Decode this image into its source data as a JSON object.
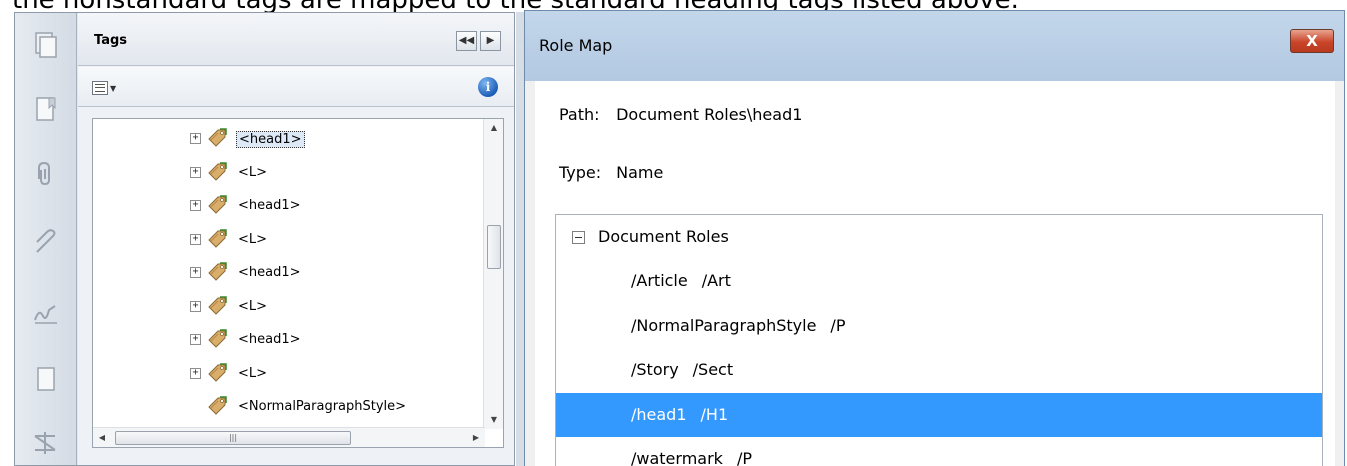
{
  "caption": "the nonstandard tags are mapped to the standard heading tags listed above.",
  "tags_panel": {
    "title": "Tags",
    "collapse_button": "◀◀",
    "next_button": "▶",
    "options_arrow": "▼",
    "info_label": "i",
    "tree_items": [
      {
        "label": "<head1>",
        "expandable": true,
        "selected": true
      },
      {
        "label": "<L>",
        "expandable": true,
        "selected": false
      },
      {
        "label": "<head1>",
        "expandable": true,
        "selected": false
      },
      {
        "label": "<L>",
        "expandable": true,
        "selected": false
      },
      {
        "label": "<head1>",
        "expandable": true,
        "selected": false
      },
      {
        "label": "<L>",
        "expandable": true,
        "selected": false
      },
      {
        "label": "<head1>",
        "expandable": true,
        "selected": false
      },
      {
        "label": "<L>",
        "expandable": true,
        "selected": false
      },
      {
        "label": "<NormalParagraphStyle>",
        "expandable": false,
        "selected": false
      }
    ]
  },
  "rail_icons": [
    "pages-icon",
    "bookmark-icon",
    "attachment-icon",
    "paperclip-icon",
    "signature-icon",
    "document-icon",
    "tags-icon"
  ],
  "dialog": {
    "title": "Role Map",
    "close_label": "X",
    "path_label": "Path:",
    "path_value": "Document Roles\\head1",
    "type_label": "Type:",
    "type_value": "Name",
    "root_label": "Document Roles",
    "roles": [
      {
        "from": "/Article",
        "to": "/Art",
        "selected": false
      },
      {
        "from": "/NormalParagraphStyle",
        "to": "/P",
        "selected": false
      },
      {
        "from": "/Story",
        "to": "/Sect",
        "selected": false
      },
      {
        "from": "/head1",
        "to": "/H1",
        "selected": true
      },
      {
        "from": "/watermark",
        "to": "/P",
        "selected": false
      }
    ]
  },
  "colors": {
    "selection": "#3399ff",
    "titlebar": "#b9cfe6",
    "close_button": "#c9452a"
  }
}
